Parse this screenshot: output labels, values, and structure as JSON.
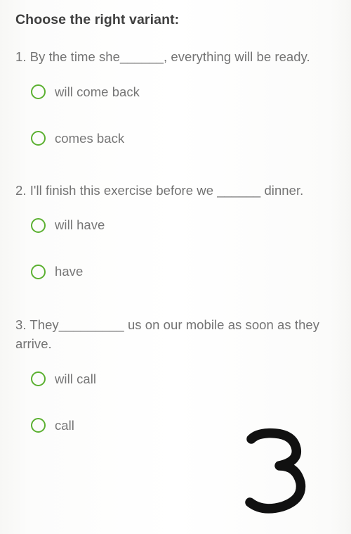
{
  "page": {
    "title": "Choose the right variant:",
    "background_color": "#ffffff",
    "text_color": "#737373",
    "accent_color": "#5bb031"
  },
  "questions": [
    {
      "number": "1.",
      "text": "1. By the time she______, everything will be ready.",
      "options": [
        {
          "label": "will come back",
          "selected": false
        },
        {
          "label": "comes back",
          "selected": false
        }
      ]
    },
    {
      "number": "2.",
      "text": "2. I'll finish this exercise before we ______ dinner.",
      "options": [
        {
          "label": "will have",
          "selected": false
        },
        {
          "label": "have",
          "selected": false
        }
      ]
    },
    {
      "number": "3.",
      "text": "3. They_________ us on our mobile as soon as they arrive.",
      "options": [
        {
          "label": "will call",
          "selected": false
        },
        {
          "label": "call",
          "selected": false
        }
      ]
    }
  ],
  "annotation": {
    "text": "3",
    "color": "#111111",
    "style": "handwritten"
  }
}
